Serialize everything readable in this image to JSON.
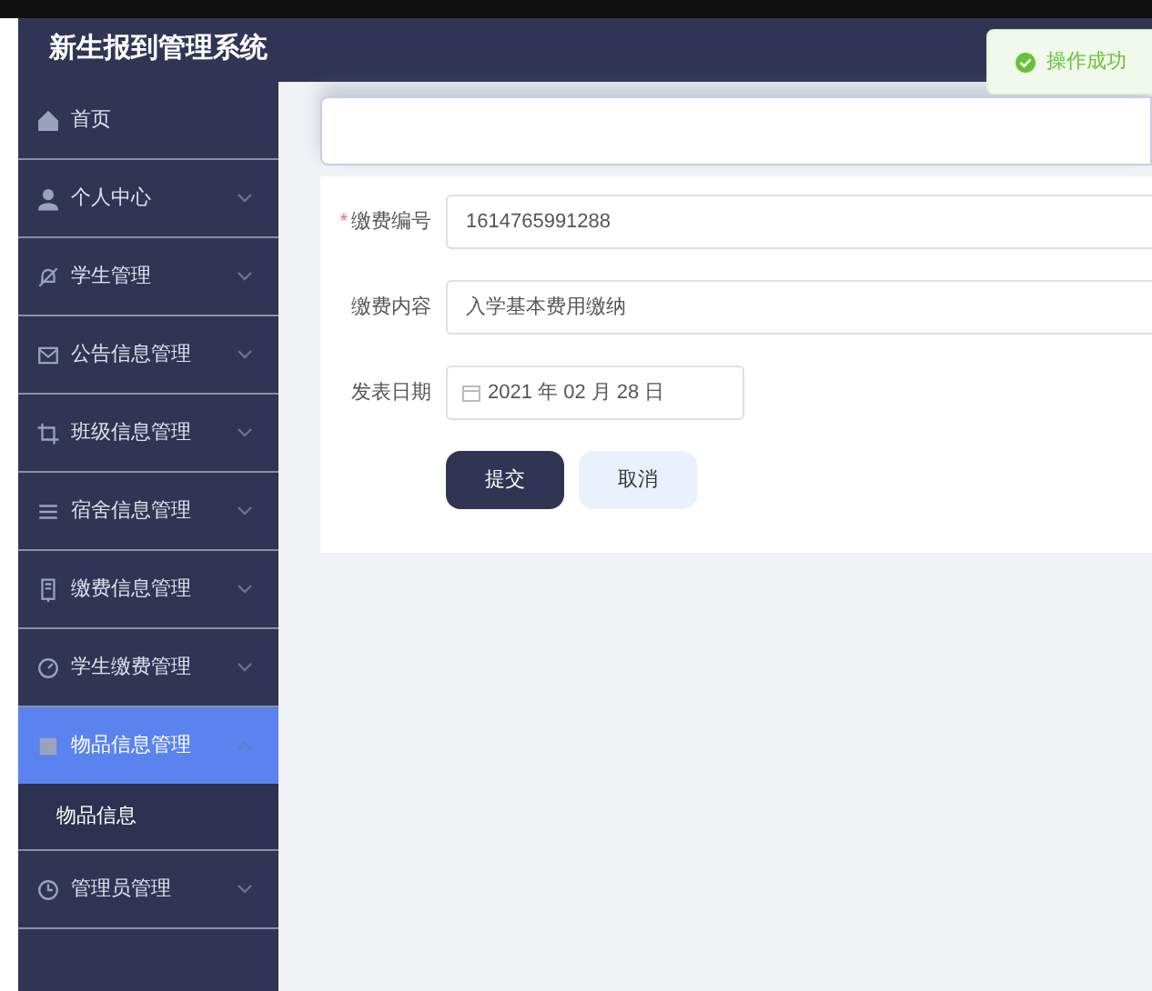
{
  "header": {
    "title": "新生报到管理系统"
  },
  "toast": {
    "message": "操作成功"
  },
  "sidebar": {
    "items": [
      {
        "kind": "home",
        "label": "首页",
        "selected": false
      },
      {
        "kind": "user",
        "label": "个人中心",
        "selected": false,
        "expanded": false
      },
      {
        "kind": "bell",
        "label": "学生管理",
        "selected": false,
        "expanded": false
      },
      {
        "kind": "mail",
        "label": "公告信息管理",
        "selected": false,
        "expanded": false
      },
      {
        "kind": "crop",
        "label": "班级信息管理",
        "selected": false,
        "expanded": false
      },
      {
        "kind": "list",
        "label": "宿舍信息管理",
        "selected": false,
        "expanded": false
      },
      {
        "kind": "phone",
        "label": "缴费信息管理",
        "selected": false,
        "expanded": false
      },
      {
        "kind": "gauge",
        "label": "学生缴费管理",
        "selected": false,
        "expanded": false
      },
      {
        "kind": "box",
        "label": "物品信息管理",
        "selected": true,
        "expanded": true,
        "children": [
          {
            "label": "物品信息"
          }
        ]
      },
      {
        "kind": "clock",
        "label": "管理员管理",
        "selected": false,
        "expanded": false
      }
    ]
  },
  "form": {
    "fields": [
      {
        "kind": "text",
        "required_marker": "*",
        "label": "缴费编号",
        "value": "1614765991288"
      },
      {
        "kind": "text",
        "label": "缴费内容",
        "value": "入学基本费用缴纳"
      },
      {
        "kind": "date",
        "label": "发表日期",
        "value": "2021 年 02 月 28 日"
      }
    ],
    "buttons": [
      {
        "kind": "primary",
        "label": "提交"
      },
      {
        "kind": "secondary",
        "label": "取消"
      }
    ]
  }
}
